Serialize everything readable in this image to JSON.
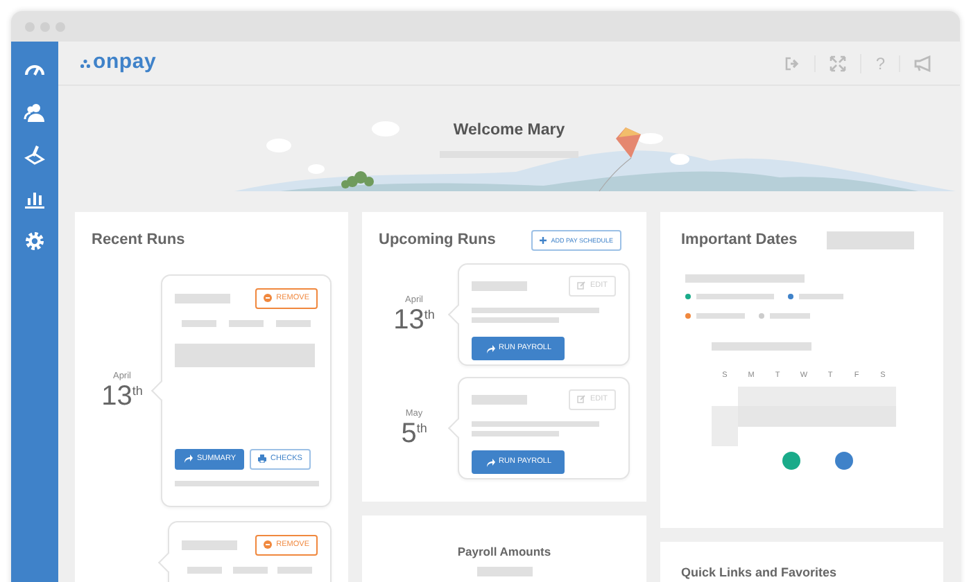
{
  "app": {
    "logo": "onpay",
    "help": "?"
  },
  "welcome": {
    "title": "Welcome Mary"
  },
  "recent_runs": {
    "title": "Recent Runs",
    "runs": [
      {
        "month": "April",
        "day": "13",
        "suffix": "th",
        "remove": "REMOVE",
        "buttons": [
          {
            "label": "SUMMARY",
            "kind": "primary"
          },
          {
            "label": "CHECKS",
            "kind": "outline"
          }
        ]
      },
      {
        "remove": "REMOVE"
      }
    ]
  },
  "upcoming_runs": {
    "title": "Upcoming Runs",
    "add_button": "ADD PAY SCHEDULE",
    "runs": [
      {
        "month": "April",
        "day": "13",
        "suffix": "th",
        "edit": "EDIT",
        "action": "RUN PAYROLL"
      },
      {
        "month": "May",
        "day": "5",
        "suffix": "th",
        "edit": "EDIT",
        "action": "RUN PAYROLL"
      }
    ]
  },
  "payroll_amounts": {
    "title": "Payroll Amounts"
  },
  "important_dates": {
    "title": "Important Dates",
    "legend": [
      {
        "color": "#1aab8a"
      },
      {
        "color": "#3f82c9"
      },
      {
        "color": "#f0883e"
      },
      {
        "color": "#cccccc"
      }
    ],
    "weekdays": [
      "S",
      "M",
      "T",
      "W",
      "T",
      "F",
      "S"
    ],
    "events": [
      {
        "color": "#1aab8a"
      },
      {
        "color": "#3f82c9"
      }
    ]
  },
  "quick_links": {
    "title": "Quick Links and Favorites"
  }
}
